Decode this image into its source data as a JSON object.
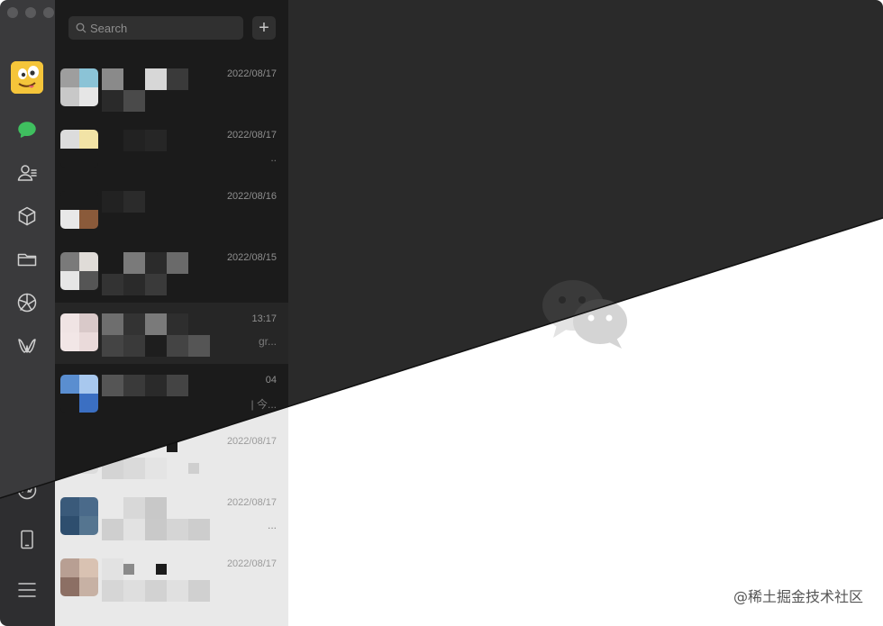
{
  "window": {
    "title": "WeChat"
  },
  "search": {
    "placeholder": "Search",
    "add_label": "+"
  },
  "nav": [
    {
      "name": "chats-icon"
    },
    {
      "name": "contacts-icon"
    },
    {
      "name": "favorites-icon"
    },
    {
      "name": "files-icon"
    },
    {
      "name": "moments-icon"
    },
    {
      "name": "mini-programs-icon"
    },
    {
      "name": "channels-icon"
    },
    {
      "name": "phone-icon"
    },
    {
      "name": "menu-icon"
    }
  ],
  "chats": [
    {
      "time": "2022/08/17",
      "preview": ""
    },
    {
      "time": "2022/08/17",
      "preview": ".."
    },
    {
      "time": "2022/08/16",
      "preview": ""
    },
    {
      "time": "2022/08/15",
      "preview": ""
    },
    {
      "time": "13:17",
      "preview": "gr..."
    },
    {
      "time": "04",
      "preview": "| 今..."
    },
    {
      "time": "2022/08/17",
      "preview": ""
    },
    {
      "time": "2022/08/17",
      "preview": "..."
    },
    {
      "time": "2022/08/17",
      "preview": ""
    }
  ],
  "watermark": "@稀土掘金技术社区",
  "colors": {
    "dark_sidebar": "#3a3a3c",
    "dark_list": "#1b1b1b",
    "dark_main": "#2a2a2a",
    "light_list": "#e9e9e9",
    "light_main": "#ffffff",
    "logo_gray": "#d9d9d9"
  }
}
